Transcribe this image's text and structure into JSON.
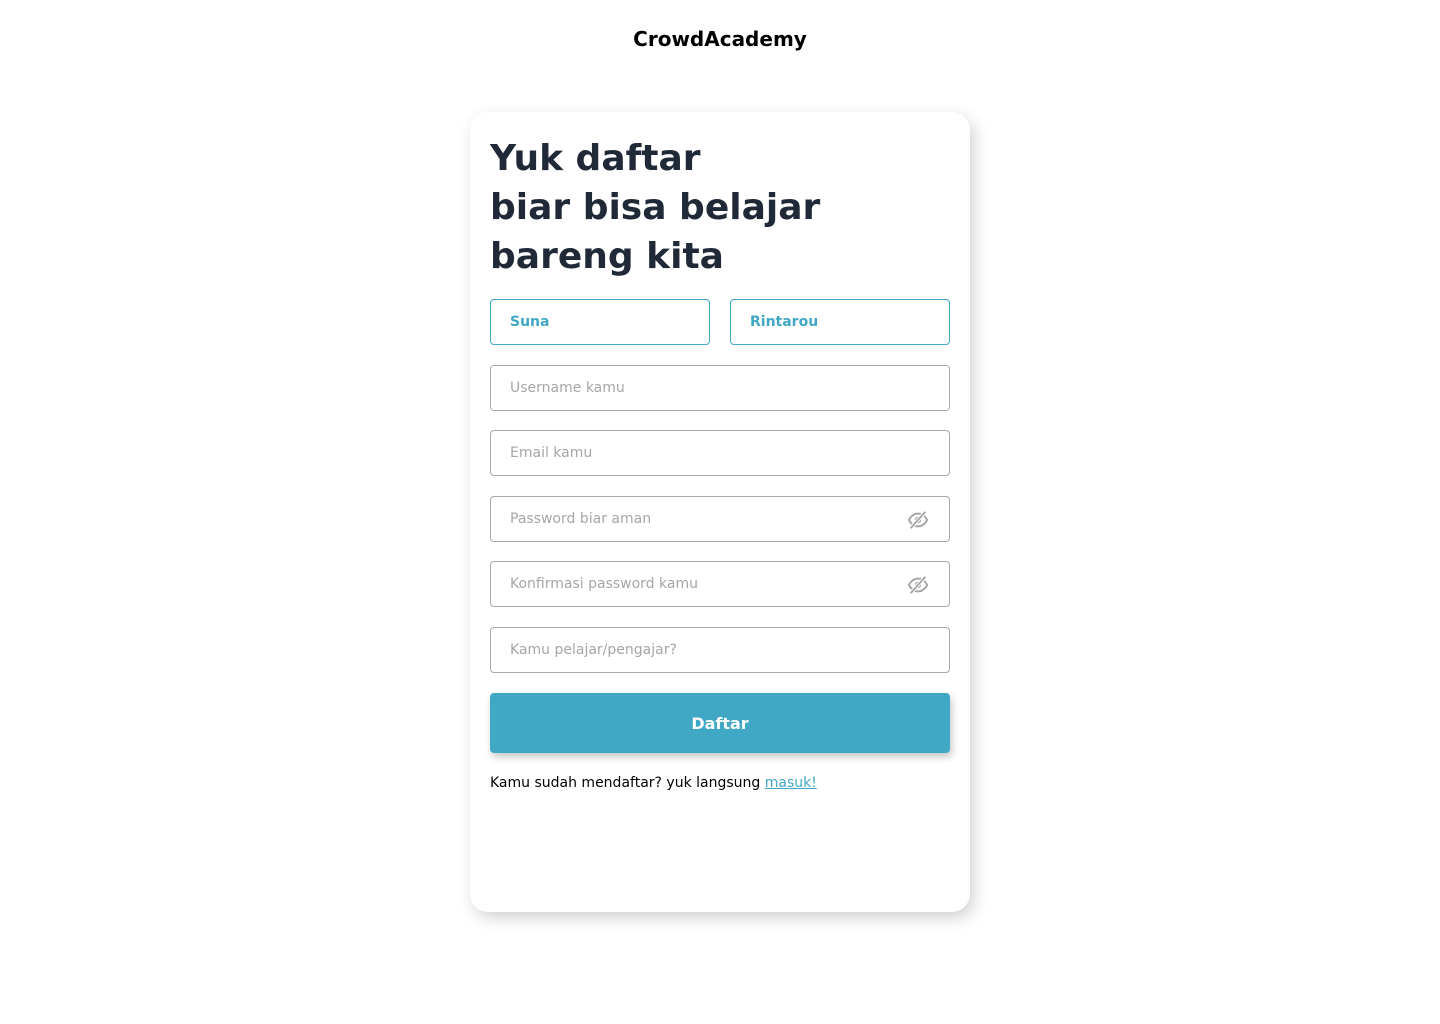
{
  "brand": "CrowdAcademy",
  "heading": {
    "line1": "Yuk daftar",
    "line2": "biar bisa belajar",
    "line3": "bareng kita"
  },
  "form": {
    "first_name_value": "Suna",
    "last_name_value": "Rintarou",
    "username_placeholder": "Username kamu",
    "email_placeholder": "Email kamu",
    "password_placeholder": "Password biar aman",
    "confirm_password_placeholder": "Konfirmasi password kamu",
    "role_placeholder": "Kamu pelajar/pengajar?",
    "submit_label": "Daftar"
  },
  "footer": {
    "text": "Kamu sudah mendaftar? yuk langsung ",
    "link_label": "masuk!"
  },
  "icons": {
    "password_toggle": "eye-slash-icon",
    "confirm_password_toggle": "eye-slash-icon"
  },
  "colors": {
    "accent": "#40a8c4",
    "heading": "#1f2937",
    "placeholder": "#a6a6a6",
    "border": "#a9a9a9"
  }
}
